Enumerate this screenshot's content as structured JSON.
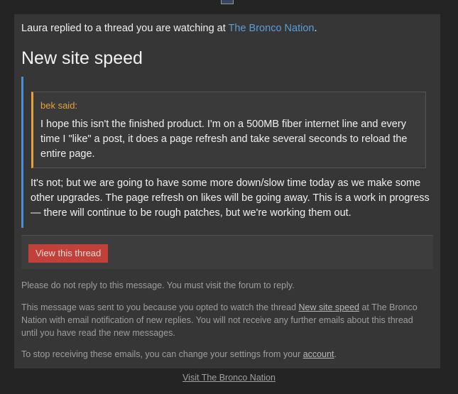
{
  "email": {
    "intro_prefix": "Laura replied to a thread you are watching at ",
    "intro_site_link": "The Bronco Nation",
    "intro_suffix": ".",
    "thread_title": "New site speed",
    "quote": {
      "author_label": "bek said:",
      "text": "I hope this isn't the finished product. I'm on a 500MB fiber internet line and every time I \"like\" a post, it does a page refresh and take several seconds to reload the entire page."
    },
    "reply_text": "It's not; but we are going to have some more down/slow time today as we make some other upgrades. The page refresh on likes will be going away. This is a work in progress — there will continue to be rough patches, but we're working them out.",
    "view_button": "View this thread",
    "no_reply_note": "Please do not reply to this message. You must visit the forum to reply.",
    "sent_note_prefix": "This message was sent to you because you opted to watch the thread ",
    "sent_note_link": "New site speed",
    "sent_note_suffix": " at The Bronco Nation with email notification of new replies. You will not receive any further emails about this thread until you have read the new messages.",
    "stop_note_prefix": "To stop receiving these emails, you can change your settings from your ",
    "stop_note_link": "account",
    "stop_note_suffix": ".",
    "visit_link": "Visit The Bronco Nation"
  },
  "colors": {
    "background": "#242424",
    "card": "#363636",
    "link": "#5b9dd9",
    "quote_accent": "#e5a23a",
    "reply_accent": "#4a90d9",
    "button": "#c1403a"
  }
}
